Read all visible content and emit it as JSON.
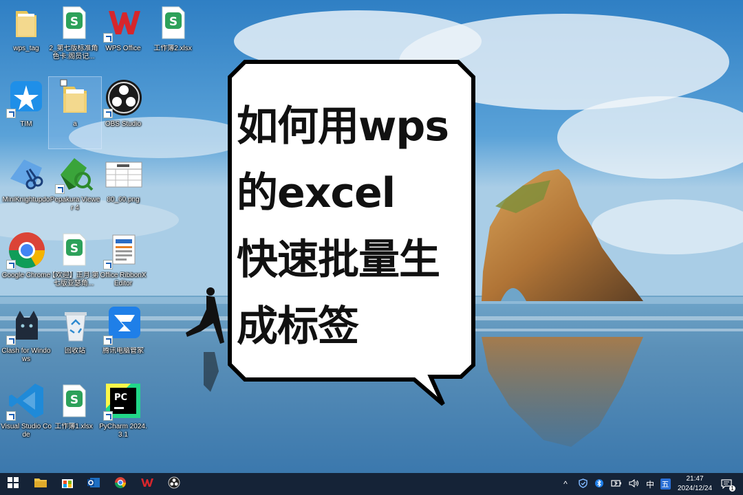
{
  "desktop": {
    "icons": [
      {
        "label": "wps_tag"
      },
      {
        "label": "2_第七版标准角色卡:阁员记..."
      },
      {
        "label": "WPS Office"
      },
      {
        "label": "工作簿2.xlsx"
      },
      {
        "label": "TIM"
      },
      {
        "label": "a"
      },
      {
        "label": "OBS Studio"
      },
      {
        "label": "MiniKnightupdo"
      },
      {
        "label": "Pepakura Viewer 4"
      },
      {
        "label": "80_60.png"
      },
      {
        "label": "Google Chrome"
      },
      {
        "label": "【欢迎】正月:第七版亚瑟角..."
      },
      {
        "label": "Office RibbonX Editor"
      },
      {
        "label": "Clash for Windows"
      },
      {
        "label": "回收站"
      },
      {
        "label": "腾讯电脑管家"
      },
      {
        "label": "Visual Studio Code"
      },
      {
        "label": "工作簿1.xlsx"
      },
      {
        "label": "PyCharm 2024.3.1"
      }
    ]
  },
  "bubble": {
    "lines": [
      "如何用wps",
      "的excel",
      "快速批量生",
      "成标签"
    ]
  },
  "taskbar": {
    "tray": {
      "chevron": "^",
      "ime_lang": "中",
      "ime_mode": "五"
    },
    "clock": {
      "time": "21:47",
      "date": "2024/12/24"
    },
    "notification_count": "1"
  },
  "colors": {
    "wps_red": "#d6262c",
    "wps_green": "#2da15a",
    "taskbar": "#121c2c"
  }
}
